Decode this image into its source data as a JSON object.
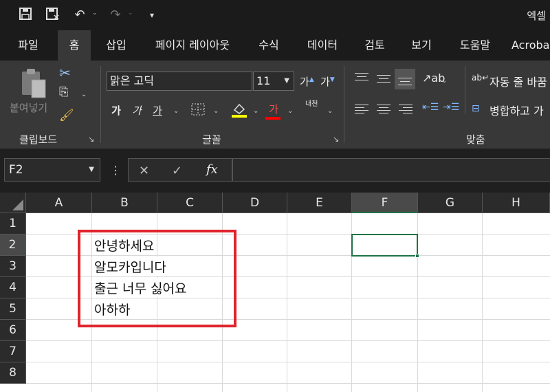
{
  "window": {
    "title": "엑셀"
  },
  "menu": {
    "tabs": [
      "파일",
      "홈",
      "삽입",
      "페이지 레이아웃",
      "수식",
      "데이터",
      "검토",
      "보기",
      "도움말",
      "Acroba"
    ],
    "active_tab": "홈"
  },
  "ribbon": {
    "clipboard": {
      "paste_label": "붙여넣기",
      "group_label": "클립보드"
    },
    "font": {
      "font_name": "맑은 고딕",
      "font_size": "11",
      "grow_label": "가",
      "shrink_label": "가",
      "bold_label": "가",
      "italic_label": "가",
      "underline_label": "가",
      "font_color_label": "가",
      "phonetic_label": "내천",
      "group_label": "글꼴",
      "fill_color": "#ffff00",
      "font_color": "#ff0000"
    },
    "alignment": {
      "wrap_text_label": "자동 줄 바꿈",
      "merge_label": "병합하고 가",
      "group_label": "맞춤"
    }
  },
  "formula_bar": {
    "name_box": "F2",
    "fx_label": "fx",
    "formula": ""
  },
  "sheet": {
    "columns": [
      "A",
      "B",
      "C",
      "D",
      "E",
      "F",
      "G",
      "H"
    ],
    "rows": [
      "1",
      "2",
      "3",
      "4",
      "5",
      "6",
      "7",
      "8"
    ],
    "selected_column": "F",
    "selected_row": "2",
    "active_cell": "F2",
    "cells": {
      "B2": "안녕하세요",
      "B3": "알모카입니다",
      "B4": "출근 너무 싫어요",
      "B5": "아하하"
    },
    "highlight_color": "#e0242c",
    "accent_color": "#1f7246"
  }
}
